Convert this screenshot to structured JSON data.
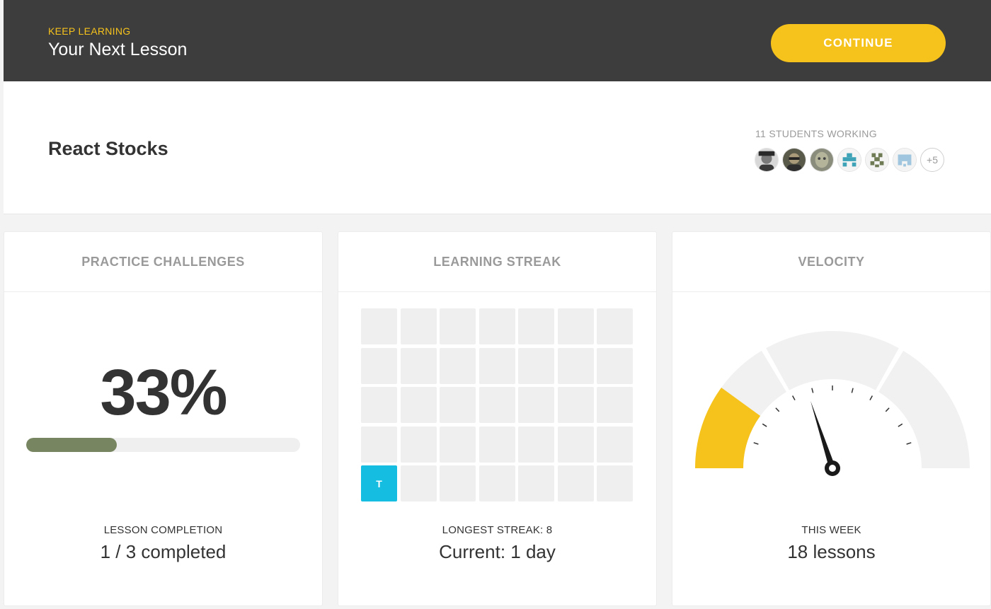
{
  "header": {
    "eyebrow": "KEEP LEARNING",
    "title": "Your Next Lesson",
    "continue_label": "CONTINUE",
    "accent_color": "#f6c21c",
    "background_color": "#3d3d3d"
  },
  "lesson": {
    "course_title": "React Stocks",
    "students_label": "11 STUDENTS WORKING",
    "avatars": [
      "avatar-photo",
      "avatar-photo",
      "avatar-photo",
      "avatar-identicon",
      "avatar-identicon",
      "avatar-identicon"
    ],
    "more_count": "+5"
  },
  "practice": {
    "heading": "PRACTICE CHALLENGES",
    "percent_label": "33%",
    "progress_fraction": 0.33,
    "progress_color": "#778660",
    "footer_label": "LESSON COMPLETION",
    "footer_value": "1 / 3 completed"
  },
  "streak": {
    "heading": "LEARNING STREAK",
    "rows": 5,
    "cols": 7,
    "active_cells": [
      {
        "row": 4,
        "col": 0,
        "label": "T"
      }
    ],
    "active_color": "#15bde0",
    "footer_label": "LONGEST STREAK: 8",
    "footer_value": "Current: 1 day"
  },
  "velocity": {
    "heading": "VELOCITY",
    "gauge_fraction": 0.2,
    "needle_fraction": 0.4,
    "fill_color": "#f6c21c",
    "footer_label": "THIS WEEK",
    "footer_value": "18 lessons"
  }
}
